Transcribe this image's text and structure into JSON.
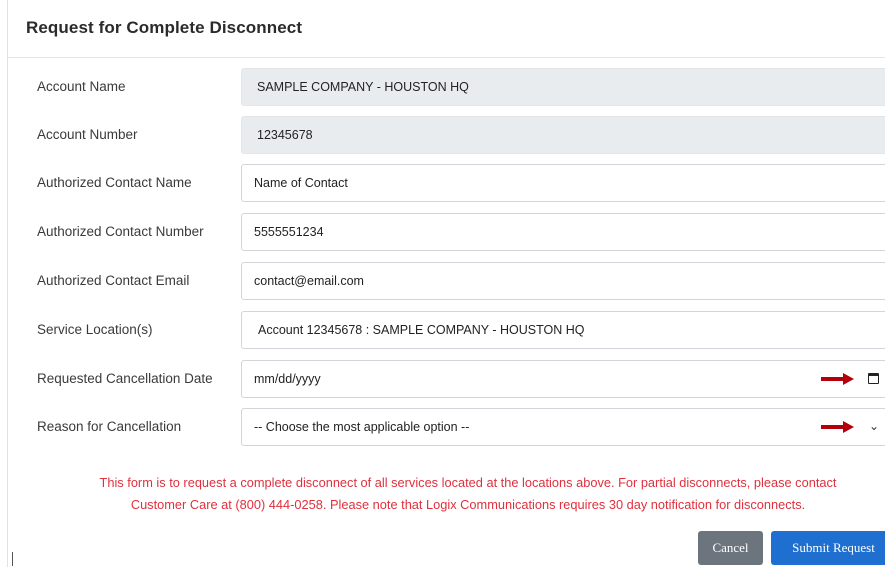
{
  "modal": {
    "title": "Request for Complete Disconnect"
  },
  "form": {
    "account_name": {
      "label": "Account Name",
      "value": "SAMPLE COMPANY - HOUSTON HQ"
    },
    "account_number": {
      "label": "Account Number",
      "value": "12345678"
    },
    "contact_name": {
      "label": "Authorized Contact Name",
      "value": "Name of Contact"
    },
    "contact_number": {
      "label": "Authorized Contact Number",
      "value": "5555551234"
    },
    "contact_email": {
      "label": "Authorized Contact Email",
      "value": "contact@email.com"
    },
    "service_location": {
      "label": "Service Location(s)",
      "value": "Account 12345678 : SAMPLE COMPANY - HOUSTON HQ"
    },
    "cancellation_date": {
      "label": "Requested Cancellation Date",
      "placeholder": "mm/dd/yyyy",
      "icon": "calendar-icon"
    },
    "reason": {
      "label": "Reason for Cancellation",
      "selected": "-- Choose the most applicable option --",
      "icon": "chevron-down-icon"
    }
  },
  "notice": {
    "line1": "This form is to request a complete disconnect of all services located at the locations above. For partial disconnects, please contact",
    "line2": "Customer Care at (800) 444-0258. Please note that Logix Communications requires 30 day notification for disconnects."
  },
  "buttons": {
    "cancel": "Cancel",
    "submit": "Submit Request"
  },
  "colors": {
    "notice": "#e0303d",
    "arrow": "#b3000b",
    "submit": "#1f6fd0",
    "cancel": "#6c757d"
  }
}
